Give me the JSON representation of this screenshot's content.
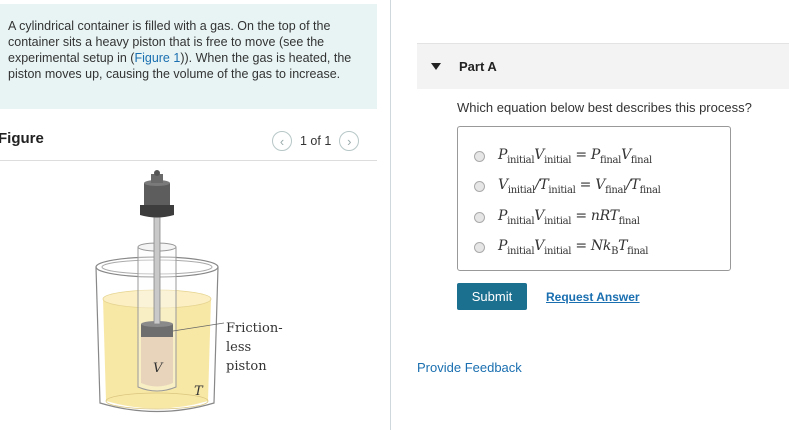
{
  "intro": {
    "text_before": "A cylindrical container is filled with a gas. On the top of the container sits a heavy piston that is free to move (see the experimental setup in (",
    "link": "Figure 1",
    "text_after": ")). When the gas is heated, the piston moves up, causing the volume of the gas to increase."
  },
  "figure": {
    "title": "Figure",
    "pager": "1 of 1",
    "prev_icon": "chevron-left-icon",
    "next_icon": "chevron-right-icon",
    "label_friction1": "Friction-",
    "label_friction2": "less",
    "label_piston": "piston",
    "label_V": "V",
    "label_T": "T"
  },
  "partA": {
    "caret_icon": "caret-down-icon",
    "label": "Part A",
    "question": "Which equation below best describes this process?"
  },
  "options": [
    {
      "id": "opt1"
    },
    {
      "id": "opt2"
    },
    {
      "id": "opt3"
    },
    {
      "id": "opt4"
    }
  ],
  "buttons": {
    "submit": "Submit",
    "request_answer": "Request Answer"
  },
  "feedback": "Provide Feedback",
  "colors": {
    "intro_bg": "#e8f4f4",
    "submit_bg": "#1b6f8f",
    "link": "#1a6fb0",
    "liquid": "#f8e8a6"
  }
}
